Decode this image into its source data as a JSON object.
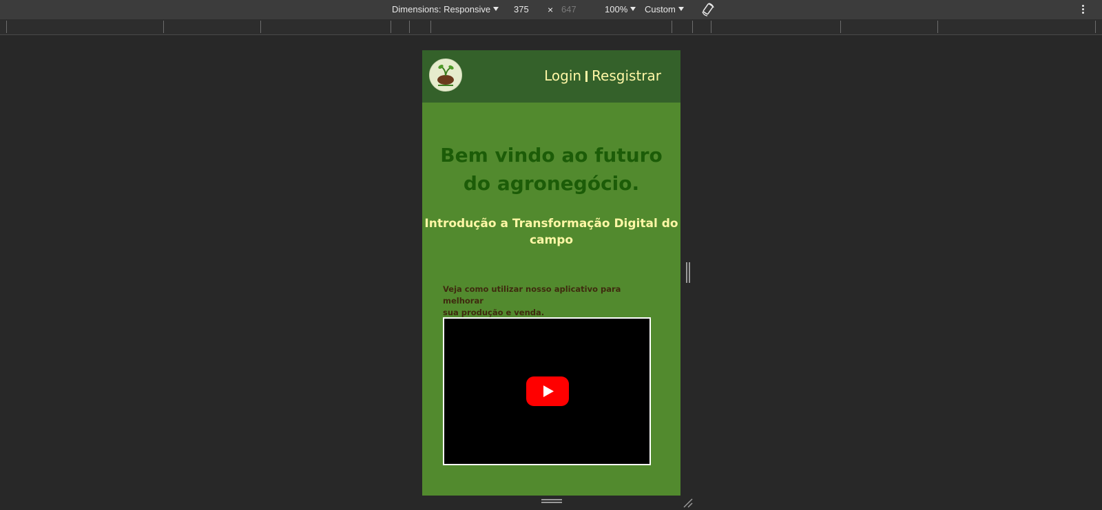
{
  "devtools": {
    "dimensions_label": "Dimensions: Responsive",
    "width_value": "375",
    "times": "×",
    "height_placeholder": "647",
    "zoom": "100%",
    "throttle": "Custom",
    "icons": [
      "caret-down-icon",
      "rotate-icon",
      "kebab-menu-icon"
    ]
  },
  "site": {
    "header": {
      "logo_name": "agro-logo",
      "login": "Login",
      "register": "Resgistrar"
    },
    "hero_title_line1": "Bem vindo ao futuro",
    "hero_title_line2": "do agronegócio.",
    "subtitle_line1": "Introdução a Transformação Digital do",
    "subtitle_line2": "campo",
    "description_line1": "Veja como utilizar nosso aplicativo para melhorar",
    "description_line2": "sua produção e venda.",
    "video_icon": "youtube-play-icon"
  },
  "colors": {
    "page_background": "#528a2e",
    "header_background": "#34612a",
    "accent_text": "#fff7a6",
    "title_text": "#1c5c08",
    "description_text": "#3f2a0f",
    "youtube_red": "#ff0000"
  }
}
